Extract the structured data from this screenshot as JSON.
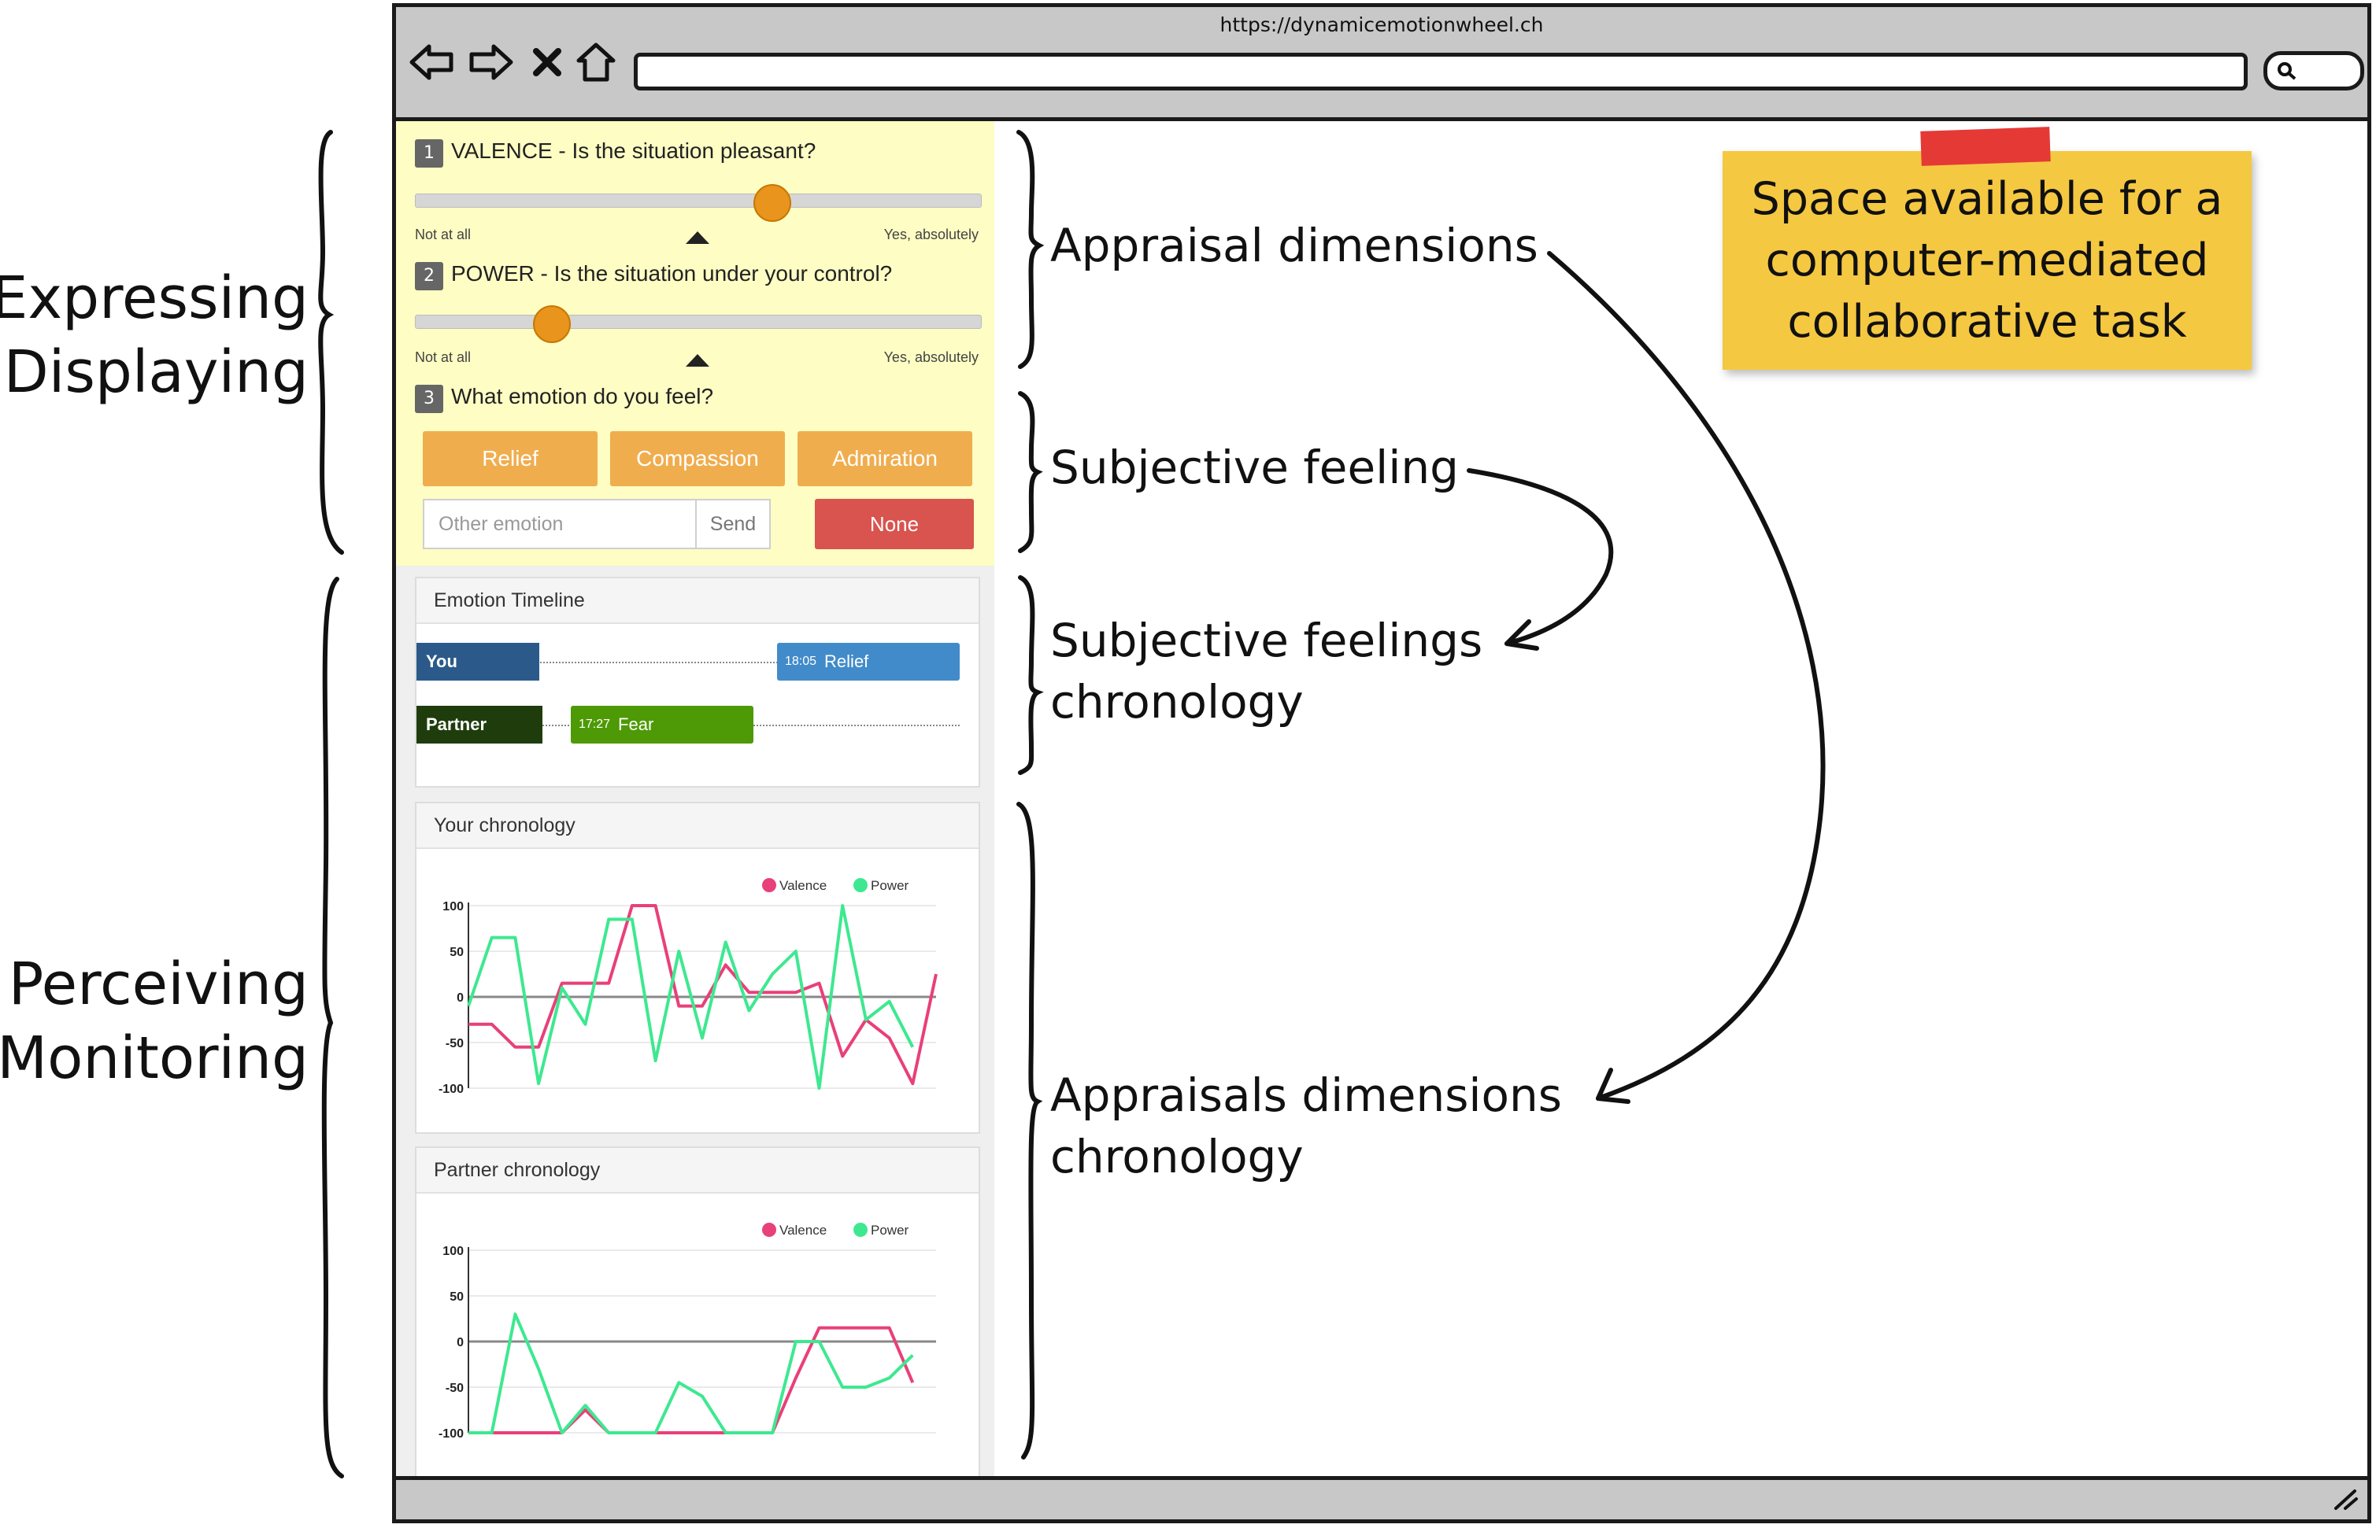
{
  "browser": {
    "url": "https://dynamicemotionwheel.ch",
    "icons": [
      "back-arrow-icon",
      "forward-arrow-icon",
      "close-icon",
      "home-icon",
      "search-icon",
      "resize-grip-icon"
    ]
  },
  "appraisal": {
    "q1": {
      "num": "1",
      "text": "VALENCE - Is the situation pleasant?",
      "min_label": "Not at all",
      "max_label": "Yes, absolutely",
      "value": 0.63
    },
    "q2": {
      "num": "2",
      "text": "POWER - Is the situation under your control?",
      "min_label": "Not at all",
      "max_label": "Yes, absolutely",
      "value": 0.24
    },
    "q3": {
      "num": "3",
      "text": "What emotion do you feel?"
    },
    "emotions": [
      "Relief",
      "Compassion",
      "Admiration"
    ],
    "other_placeholder": "Other emotion",
    "send_label": "Send",
    "none_label": "None"
  },
  "timeline": {
    "title": "Emotion Timeline",
    "you_label": "You",
    "partner_label": "Partner",
    "you_event": {
      "time": "18:05",
      "emotion": "Relief"
    },
    "partner_event": {
      "time": "17:27",
      "emotion": "Fear"
    }
  },
  "your_chronology": {
    "title": "Your chronology"
  },
  "partner_chronology": {
    "title": "Partner chronology"
  },
  "chart_data": [
    {
      "type": "line",
      "title": "Your chronology",
      "ylim": [
        -100,
        100
      ],
      "yticks": [
        "100",
        "50",
        "0",
        "-50",
        "-100"
      ],
      "legend": "top-right",
      "colors": {
        "Valence": "#e8407a",
        "Power": "#3ee890"
      },
      "series": [
        {
          "name": "Valence",
          "values": [
            -30,
            -30,
            -55,
            -55,
            15,
            15,
            15,
            100,
            100,
            -10,
            -10,
            35,
            5,
            5,
            5,
            15,
            -65,
            -25,
            -45,
            -95,
            25
          ]
        },
        {
          "name": "Power",
          "values": [
            -10,
            65,
            65,
            -95,
            10,
            -30,
            85,
            85,
            -70,
            50,
            -45,
            60,
            -15,
            25,
            50,
            -100,
            100,
            -25,
            -5,
            -55,
            null
          ]
        }
      ]
    },
    {
      "type": "line",
      "title": "Partner chronology",
      "ylim": [
        -100,
        100
      ],
      "yticks": [
        "100",
        "50",
        "0",
        "-50",
        "-100"
      ],
      "legend": "top-right",
      "colors": {
        "Valence": "#e8407a",
        "Power": "#3ee890"
      },
      "series": [
        {
          "name": "Valence",
          "values": [
            -100,
            -100,
            -100,
            -100,
            -100,
            -75,
            -100,
            -100,
            -100,
            -100,
            -100,
            -100,
            -100,
            -100,
            -40,
            15,
            15,
            15,
            15,
            -45,
            null
          ]
        },
        {
          "name": "Power",
          "values": [
            -100,
            -100,
            30,
            -30,
            -100,
            -70,
            -100,
            -100,
            -100,
            -45,
            -60,
            -100,
            -100,
            -100,
            0,
            0,
            -50,
            -50,
            -40,
            -15,
            null
          ]
        }
      ]
    }
  ],
  "annotations": {
    "expressing": "Expressing",
    "displaying": "Displaying",
    "perceiving": "Perceiving",
    "monitoring": "Monitoring",
    "appraisal_dimensions": "Appraisal dimensions",
    "subjective_feeling": "Subjective feeling",
    "subjective_feelings_1": "Subjective feelings",
    "subjective_feelings_2": "chronology",
    "appraisals_chrono_1": "Appraisals dimensions",
    "appraisals_chrono_2": "chronology",
    "note": "Space available for a computer-mediated collaborative task"
  }
}
